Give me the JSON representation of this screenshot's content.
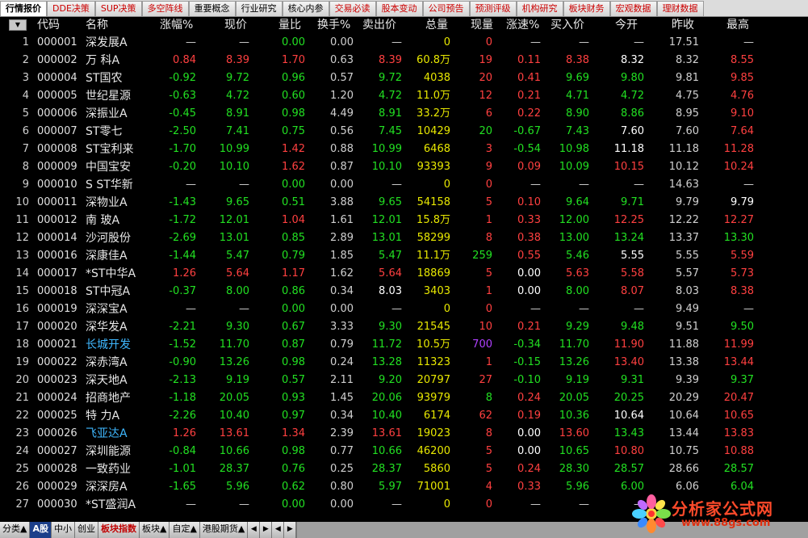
{
  "tabs": [
    {
      "label": "行情报价",
      "color": "#000000",
      "active": true
    },
    {
      "label": "DDE决策",
      "color": "#cc0000"
    },
    {
      "label": "SUP决策",
      "color": "#cc0000"
    },
    {
      "label": "多空阵线",
      "color": "#cc0000"
    },
    {
      "label": "重要概念",
      "color": "#000000"
    },
    {
      "label": "行业研究",
      "color": "#000000"
    },
    {
      "label": "核心内参",
      "color": "#000000"
    },
    {
      "label": "交易必读",
      "color": "#cc0000"
    },
    {
      "label": "股本变动",
      "color": "#cc0000"
    },
    {
      "label": "公司预告",
      "color": "#cc0000"
    },
    {
      "label": "预测评级",
      "color": "#cc0000"
    },
    {
      "label": "机构研究",
      "color": "#cc0000"
    },
    {
      "label": "板块财务",
      "color": "#cc0000"
    },
    {
      "label": "宏观数据",
      "color": "#cc0000"
    },
    {
      "label": "理财数据",
      "color": "#cc0000"
    }
  ],
  "menu_button_glyph": "▼",
  "columns": [
    "代码",
    "名称",
    "涨幅%",
    "现价",
    "量比",
    "换手%",
    "卖出价",
    "总量",
    "现量",
    "涨速%",
    "买入价",
    "今开",
    "昨收",
    "最高"
  ],
  "colors": {
    "red": "#ff4040",
    "green": "#22e022",
    "white": "#ffffff",
    "yellow": "#e8e800",
    "purple": "#b040ff",
    "link": "#3fb8ff"
  },
  "rows": [
    {
      "i": "1",
      "code": "000001",
      "name": "深发展A",
      "chg": "—",
      "price": "—",
      "lb": "0.00",
      "hs": "0.00",
      "sell": "—",
      "vol": "0",
      "xl": "0",
      "zs": "—",
      "buy": "—",
      "open": "—",
      "prev": "17.51",
      "high": "—",
      "c": {
        "chg": "gry",
        "price": "gry",
        "lb": "grn",
        "hs": "gry",
        "sell": "gry",
        "vol": "yel",
        "xl": "red",
        "zs": "gry",
        "buy": "gry",
        "open": "gry",
        "prev": "gry",
        "high": "gry"
      }
    },
    {
      "i": "2",
      "code": "000002",
      "name": "万 科A",
      "chg": "0.84",
      "price": "8.39",
      "lb": "1.70",
      "hs": "0.63",
      "sell": "8.39",
      "vol": "60.8万",
      "xl": "19",
      "zs": "0.11",
      "buy": "8.38",
      "open": "8.32",
      "prev": "8.32",
      "high": "8.55",
      "c": {
        "chg": "red",
        "price": "red",
        "lb": "red",
        "hs": "gry",
        "sell": "red",
        "vol": "yel",
        "xl": "red",
        "zs": "red",
        "buy": "red",
        "open": "wht",
        "prev": "gry",
        "high": "red"
      }
    },
    {
      "i": "3",
      "code": "000004",
      "name": "ST国农",
      "chg": "-0.92",
      "price": "9.72",
      "lb": "0.96",
      "hs": "0.57",
      "sell": "9.72",
      "vol": "4038",
      "xl": "20",
      "zs": "0.41",
      "buy": "9.69",
      "open": "9.80",
      "prev": "9.81",
      "high": "9.85",
      "c": {
        "chg": "grn",
        "price": "grn",
        "lb": "grn",
        "hs": "gry",
        "sell": "grn",
        "vol": "yel",
        "xl": "red",
        "zs": "red",
        "buy": "grn",
        "open": "grn",
        "prev": "gry",
        "high": "red"
      }
    },
    {
      "i": "4",
      "code": "000005",
      "name": "世纪星源",
      "chg": "-0.63",
      "price": "4.72",
      "lb": "0.60",
      "hs": "1.20",
      "sell": "4.72",
      "vol": "11.0万",
      "xl": "12",
      "zs": "0.21",
      "buy": "4.71",
      "open": "4.72",
      "prev": "4.75",
      "high": "4.76",
      "c": {
        "chg": "grn",
        "price": "grn",
        "lb": "grn",
        "hs": "gry",
        "sell": "grn",
        "vol": "yel",
        "xl": "red",
        "zs": "red",
        "buy": "grn",
        "open": "grn",
        "prev": "gry",
        "high": "red"
      }
    },
    {
      "i": "5",
      "code": "000006",
      "name": "深振业A",
      "chg": "-0.45",
      "price": "8.91",
      "lb": "0.98",
      "hs": "4.49",
      "sell": "8.91",
      "vol": "33.2万",
      "xl": "6",
      "zs": "0.22",
      "buy": "8.90",
      "open": "8.86",
      "prev": "8.95",
      "high": "9.10",
      "c": {
        "chg": "grn",
        "price": "grn",
        "lb": "grn",
        "hs": "gry",
        "sell": "grn",
        "vol": "yel",
        "xl": "red",
        "zs": "red",
        "buy": "grn",
        "open": "grn",
        "prev": "gry",
        "high": "red"
      }
    },
    {
      "i": "6",
      "code": "000007",
      "name": "ST零七",
      "chg": "-2.50",
      "price": "7.41",
      "lb": "0.75",
      "hs": "0.56",
      "sell": "7.45",
      "vol": "10429",
      "xl": "20",
      "zs": "-0.67",
      "buy": "7.43",
      "open": "7.60",
      "prev": "7.60",
      "high": "7.64",
      "c": {
        "chg": "grn",
        "price": "grn",
        "lb": "grn",
        "hs": "gry",
        "sell": "grn",
        "vol": "yel",
        "xl": "grn",
        "zs": "grn",
        "buy": "grn",
        "open": "wht",
        "prev": "gry",
        "high": "red"
      }
    },
    {
      "i": "7",
      "code": "000008",
      "name": "ST宝利来",
      "chg": "-1.70",
      "price": "10.99",
      "lb": "1.42",
      "hs": "0.88",
      "sell": "10.99",
      "vol": "6468",
      "xl": "3",
      "zs": "-0.54",
      "buy": "10.98",
      "open": "11.18",
      "prev": "11.18",
      "high": "11.28",
      "c": {
        "chg": "grn",
        "price": "grn",
        "lb": "red",
        "hs": "gry",
        "sell": "grn",
        "vol": "yel",
        "xl": "red",
        "zs": "grn",
        "buy": "grn",
        "open": "wht",
        "prev": "gry",
        "high": "red"
      }
    },
    {
      "i": "8",
      "code": "000009",
      "name": "中国宝安",
      "chg": "-0.20",
      "price": "10.10",
      "lb": "1.62",
      "hs": "0.87",
      "sell": "10.10",
      "vol": "93393",
      "xl": "9",
      "zs": "0.09",
      "buy": "10.09",
      "open": "10.15",
      "prev": "10.12",
      "high": "10.24",
      "c": {
        "chg": "grn",
        "price": "grn",
        "lb": "red",
        "hs": "gry",
        "sell": "grn",
        "vol": "yel",
        "xl": "red",
        "zs": "red",
        "buy": "grn",
        "open": "red",
        "prev": "gry",
        "high": "red"
      }
    },
    {
      "i": "9",
      "code": "000010",
      "name": "S ST华新",
      "chg": "—",
      "price": "—",
      "lb": "0.00",
      "hs": "0.00",
      "sell": "—",
      "vol": "0",
      "xl": "0",
      "zs": "—",
      "buy": "—",
      "open": "—",
      "prev": "14.63",
      "high": "—",
      "c": {
        "chg": "gry",
        "price": "gry",
        "lb": "grn",
        "hs": "gry",
        "sell": "gry",
        "vol": "yel",
        "xl": "red",
        "zs": "gry",
        "buy": "gry",
        "open": "gry",
        "prev": "gry",
        "high": "gry"
      }
    },
    {
      "i": "10",
      "code": "000011",
      "name": "深物业A",
      "chg": "-1.43",
      "price": "9.65",
      "lb": "0.51",
      "hs": "3.88",
      "sell": "9.65",
      "vol": "54158",
      "xl": "5",
      "zs": "0.10",
      "buy": "9.64",
      "open": "9.71",
      "prev": "9.79",
      "high": "9.79",
      "c": {
        "chg": "grn",
        "price": "grn",
        "lb": "grn",
        "hs": "gry",
        "sell": "grn",
        "vol": "yel",
        "xl": "red",
        "zs": "red",
        "buy": "grn",
        "open": "grn",
        "prev": "gry",
        "high": "wht"
      }
    },
    {
      "i": "11",
      "code": "000012",
      "name": "南 玻A",
      "chg": "-1.72",
      "price": "12.01",
      "lb": "1.04",
      "hs": "1.61",
      "sell": "12.01",
      "vol": "15.8万",
      "xl": "1",
      "zs": "0.33",
      "buy": "12.00",
      "open": "12.25",
      "prev": "12.22",
      "high": "12.27",
      "c": {
        "chg": "grn",
        "price": "grn",
        "lb": "red",
        "hs": "gry",
        "sell": "grn",
        "vol": "yel",
        "xl": "red",
        "zs": "red",
        "buy": "grn",
        "open": "red",
        "prev": "gry",
        "high": "red"
      }
    },
    {
      "i": "12",
      "code": "000014",
      "name": "沙河股份",
      "chg": "-2.69",
      "price": "13.01",
      "lb": "0.85",
      "hs": "2.89",
      "sell": "13.01",
      "vol": "58299",
      "xl": "8",
      "zs": "0.38",
      "buy": "13.00",
      "open": "13.24",
      "prev": "13.37",
      "high": "13.30",
      "c": {
        "chg": "grn",
        "price": "grn",
        "lb": "grn",
        "hs": "gry",
        "sell": "grn",
        "vol": "yel",
        "xl": "red",
        "zs": "red",
        "buy": "grn",
        "open": "grn",
        "prev": "gry",
        "high": "grn"
      }
    },
    {
      "i": "13",
      "code": "000016",
      "name": "深康佳A",
      "chg": "-1.44",
      "price": "5.47",
      "lb": "0.79",
      "hs": "1.85",
      "sell": "5.47",
      "vol": "11.1万",
      "xl": "259",
      "zs": "0.55",
      "buy": "5.46",
      "open": "5.55",
      "prev": "5.55",
      "high": "5.59",
      "c": {
        "chg": "grn",
        "price": "grn",
        "lb": "grn",
        "hs": "gry",
        "sell": "grn",
        "vol": "yel",
        "xl": "grn",
        "zs": "red",
        "buy": "grn",
        "open": "wht",
        "prev": "gry",
        "high": "red"
      }
    },
    {
      "i": "14",
      "code": "000017",
      "name": "*ST中华A",
      "chg": "1.26",
      "price": "5.64",
      "lb": "1.17",
      "hs": "1.62",
      "sell": "5.64",
      "vol": "18869",
      "xl": "5",
      "zs": "0.00",
      "buy": "5.63",
      "open": "5.58",
      "prev": "5.57",
      "high": "5.73",
      "c": {
        "chg": "red",
        "price": "red",
        "lb": "red",
        "hs": "gry",
        "sell": "red",
        "vol": "yel",
        "xl": "red",
        "zs": "wht",
        "buy": "red",
        "open": "red",
        "prev": "gry",
        "high": "red"
      }
    },
    {
      "i": "15",
      "code": "000018",
      "name": "ST中冠A",
      "chg": "-0.37",
      "price": "8.00",
      "lb": "0.86",
      "hs": "0.34",
      "sell": "8.03",
      "vol": "3403",
      "xl": "1",
      "zs": "0.00",
      "buy": "8.00",
      "open": "8.07",
      "prev": "8.03",
      "high": "8.38",
      "c": {
        "chg": "grn",
        "price": "grn",
        "lb": "grn",
        "hs": "gry",
        "sell": "wht",
        "vol": "yel",
        "xl": "red",
        "zs": "wht",
        "buy": "grn",
        "open": "red",
        "prev": "gry",
        "high": "red"
      }
    },
    {
      "i": "16",
      "code": "000019",
      "name": "深深宝A",
      "chg": "—",
      "price": "—",
      "lb": "0.00",
      "hs": "0.00",
      "sell": "—",
      "vol": "0",
      "xl": "0",
      "zs": "—",
      "buy": "—",
      "open": "—",
      "prev": "9.49",
      "high": "—",
      "c": {
        "chg": "gry",
        "price": "gry",
        "lb": "grn",
        "hs": "gry",
        "sell": "gry",
        "vol": "yel",
        "xl": "red",
        "zs": "gry",
        "buy": "gry",
        "open": "gry",
        "prev": "gry",
        "high": "gry"
      }
    },
    {
      "i": "17",
      "code": "000020",
      "name": "深华发A",
      "chg": "-2.21",
      "price": "9.30",
      "lb": "0.67",
      "hs": "3.33",
      "sell": "9.30",
      "vol": "21545",
      "xl": "10",
      "zs": "0.21",
      "buy": "9.29",
      "open": "9.48",
      "prev": "9.51",
      "high": "9.50",
      "c": {
        "chg": "grn",
        "price": "grn",
        "lb": "grn",
        "hs": "gry",
        "sell": "grn",
        "vol": "yel",
        "xl": "red",
        "zs": "red",
        "buy": "grn",
        "open": "grn",
        "prev": "gry",
        "high": "grn"
      }
    },
    {
      "i": "18",
      "code": "000021",
      "name": "长城开发",
      "link": true,
      "chg": "-1.52",
      "price": "11.70",
      "lb": "0.87",
      "hs": "0.79",
      "sell": "11.72",
      "vol": "10.5万",
      "xl": "700",
      "zs": "-0.34",
      "buy": "11.70",
      "open": "11.90",
      "prev": "11.88",
      "high": "11.99",
      "c": {
        "chg": "grn",
        "price": "grn",
        "lb": "grn",
        "hs": "gry",
        "sell": "grn",
        "vol": "yel",
        "xl": "pur",
        "zs": "grn",
        "buy": "grn",
        "open": "red",
        "prev": "gry",
        "high": "red"
      }
    },
    {
      "i": "19",
      "code": "000022",
      "name": "深赤湾A",
      "chg": "-0.90",
      "price": "13.26",
      "lb": "0.98",
      "hs": "0.24",
      "sell": "13.28",
      "vol": "11323",
      "xl": "1",
      "zs": "-0.15",
      "buy": "13.26",
      "open": "13.40",
      "prev": "13.38",
      "high": "13.44",
      "c": {
        "chg": "grn",
        "price": "grn",
        "lb": "grn",
        "hs": "gry",
        "sell": "grn",
        "vol": "yel",
        "xl": "red",
        "zs": "grn",
        "buy": "grn",
        "open": "red",
        "prev": "gry",
        "high": "red"
      }
    },
    {
      "i": "20",
      "code": "000023",
      "name": "深天地A",
      "chg": "-2.13",
      "price": "9.19",
      "lb": "0.57",
      "hs": "2.11",
      "sell": "9.20",
      "vol": "20797",
      "xl": "27",
      "zs": "-0.10",
      "buy": "9.19",
      "open": "9.31",
      "prev": "9.39",
      "high": "9.37",
      "c": {
        "chg": "grn",
        "price": "grn",
        "lb": "grn",
        "hs": "gry",
        "sell": "grn",
        "vol": "yel",
        "xl": "red",
        "zs": "grn",
        "buy": "grn",
        "open": "grn",
        "prev": "gry",
        "high": "grn"
      }
    },
    {
      "i": "21",
      "code": "000024",
      "name": "招商地产",
      "chg": "-1.18",
      "price": "20.05",
      "lb": "0.93",
      "hs": "1.45",
      "sell": "20.06",
      "vol": "93979",
      "xl": "8",
      "zs": "0.24",
      "buy": "20.05",
      "open": "20.25",
      "prev": "20.29",
      "high": "20.47",
      "c": {
        "chg": "grn",
        "price": "grn",
        "lb": "grn",
        "hs": "gry",
        "sell": "grn",
        "vol": "yel",
        "xl": "grn",
        "zs": "red",
        "buy": "grn",
        "open": "grn",
        "prev": "gry",
        "high": "red"
      }
    },
    {
      "i": "22",
      "code": "000025",
      "name": "特 力A",
      "chg": "-2.26",
      "price": "10.40",
      "lb": "0.97",
      "hs": "0.34",
      "sell": "10.40",
      "vol": "6174",
      "xl": "62",
      "zs": "0.19",
      "buy": "10.36",
      "open": "10.64",
      "prev": "10.64",
      "high": "10.65",
      "c": {
        "chg": "grn",
        "price": "grn",
        "lb": "grn",
        "hs": "gry",
        "sell": "grn",
        "vol": "yel",
        "xl": "red",
        "zs": "red",
        "buy": "grn",
        "open": "wht",
        "prev": "gry",
        "high": "red"
      }
    },
    {
      "i": "23",
      "code": "000026",
      "name": "飞亚达A",
      "link": true,
      "chg": "1.26",
      "price": "13.61",
      "lb": "1.34",
      "hs": "2.39",
      "sell": "13.61",
      "vol": "19023",
      "xl": "8",
      "zs": "0.00",
      "buy": "13.60",
      "open": "13.43",
      "prev": "13.44",
      "high": "13.83",
      "c": {
        "chg": "red",
        "price": "red",
        "lb": "red",
        "hs": "gry",
        "sell": "red",
        "vol": "yel",
        "xl": "red",
        "zs": "wht",
        "buy": "red",
        "open": "grn",
        "prev": "gry",
        "high": "red"
      }
    },
    {
      "i": "24",
      "code": "000027",
      "name": "深圳能源",
      "chg": "-0.84",
      "price": "10.66",
      "lb": "0.98",
      "hs": "0.77",
      "sell": "10.66",
      "vol": "46200",
      "xl": "5",
      "zs": "0.00",
      "buy": "10.65",
      "open": "10.80",
      "prev": "10.75",
      "high": "10.88",
      "c": {
        "chg": "grn",
        "price": "grn",
        "lb": "grn",
        "hs": "gry",
        "sell": "grn",
        "vol": "yel",
        "xl": "red",
        "zs": "wht",
        "buy": "grn",
        "open": "red",
        "prev": "gry",
        "high": "red"
      }
    },
    {
      "i": "25",
      "code": "000028",
      "name": "一致药业",
      "chg": "-1.01",
      "price": "28.37",
      "lb": "0.76",
      "hs": "0.25",
      "sell": "28.37",
      "vol": "5860",
      "xl": "5",
      "zs": "0.24",
      "buy": "28.30",
      "open": "28.57",
      "prev": "28.66",
      "high": "28.57",
      "c": {
        "chg": "grn",
        "price": "grn",
        "lb": "grn",
        "hs": "gry",
        "sell": "grn",
        "vol": "yel",
        "xl": "red",
        "zs": "red",
        "buy": "grn",
        "open": "grn",
        "prev": "gry",
        "high": "grn"
      }
    },
    {
      "i": "26",
      "code": "000029",
      "name": "深深房A",
      "chg": "-1.65",
      "price": "5.96",
      "lb": "0.62",
      "hs": "0.80",
      "sell": "5.97",
      "vol": "71001",
      "xl": "4",
      "zs": "0.33",
      "buy": "5.96",
      "open": "6.00",
      "prev": "6.06",
      "high": "6.04",
      "c": {
        "chg": "grn",
        "price": "grn",
        "lb": "grn",
        "hs": "gry",
        "sell": "grn",
        "vol": "yel",
        "xl": "red",
        "zs": "red",
        "buy": "grn",
        "open": "grn",
        "prev": "gry",
        "high": "grn"
      }
    },
    {
      "i": "27",
      "code": "000030",
      "name": "*ST盛润A",
      "chg": "—",
      "price": "—",
      "lb": "0.00",
      "hs": "0.00",
      "sell": "—",
      "vol": "0",
      "xl": "0",
      "zs": "—",
      "buy": "—",
      "open": "—",
      "prev": "",
      "high": "",
      "c": {
        "chg": "gry",
        "price": "gry",
        "lb": "grn",
        "hs": "gry",
        "sell": "gry",
        "vol": "yel",
        "xl": "red",
        "zs": "gry",
        "buy": "gry",
        "open": "gry",
        "prev": "gry",
        "high": "gry"
      }
    }
  ],
  "bottom_tabs": [
    {
      "label": "分类▲",
      "style": "normal"
    },
    {
      "label": "A股",
      "style": "sel"
    },
    {
      "label": "中小",
      "style": "normal"
    },
    {
      "label": "创业",
      "style": "normal"
    },
    {
      "label": "板块指数",
      "style": "red"
    },
    {
      "label": "板块▲",
      "style": "normal"
    },
    {
      "label": "自定▲",
      "style": "normal"
    },
    {
      "label": "港股期货▲",
      "style": "normal"
    }
  ],
  "nav_glyphs": [
    "◀",
    "▶",
    "◀",
    "▶"
  ],
  "watermark": {
    "title": "分析家公式网",
    "url": "www.88gs.com"
  }
}
